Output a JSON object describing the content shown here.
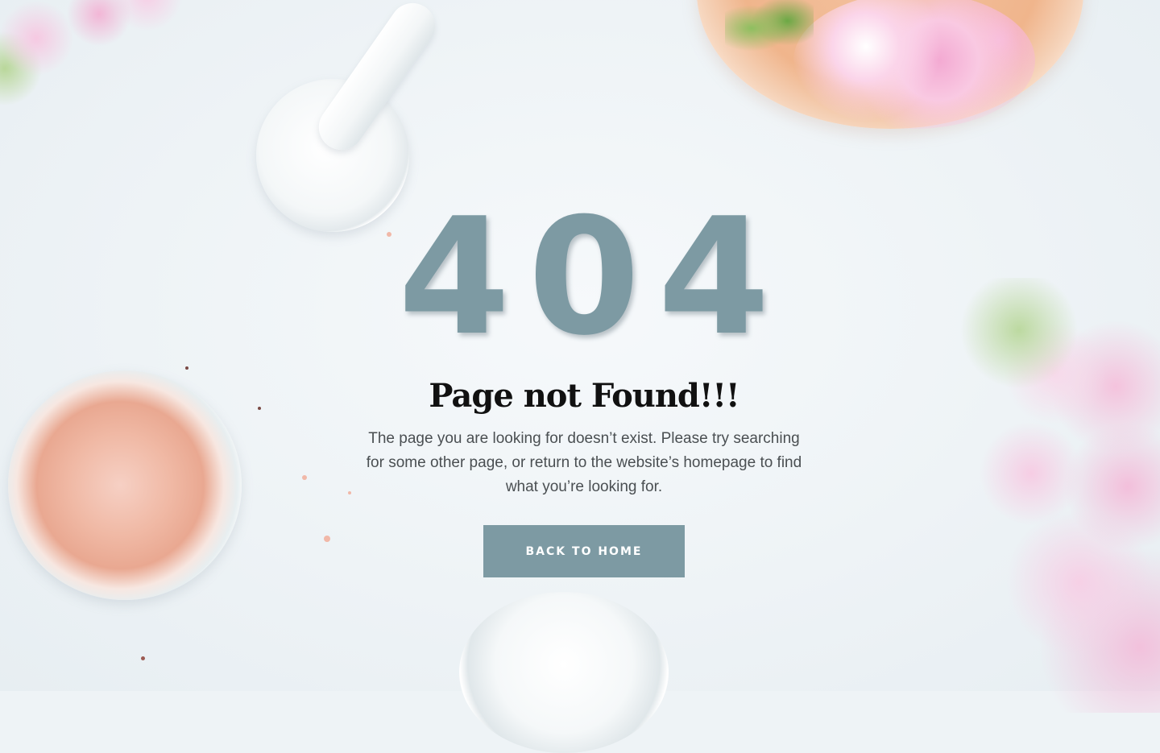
{
  "error": {
    "code": "404",
    "title": "Page not Found!!!",
    "description": "The page you are looking for doesn’t exist. Please try searching for some other page, or return to the website’s homepage to find what you’re looking for."
  },
  "actions": {
    "home_label": "BACK TO HOME"
  },
  "colors": {
    "accent": "#7d9aa3",
    "background": "#eef3f6",
    "title": "#111111",
    "text": "#4a4f52"
  }
}
